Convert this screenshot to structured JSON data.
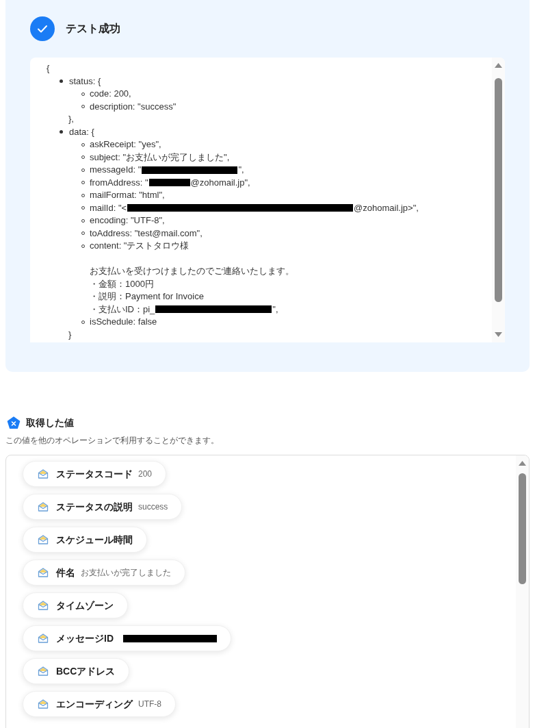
{
  "test_result": {
    "title": "テスト成功"
  },
  "json_view": {
    "open": "{",
    "items": [
      {
        "text": "status: {",
        "close": "},",
        "children": [
          {
            "lines": [
              {
                "segments": [
                  {
                    "kind": "text",
                    "text": "code: 200,"
                  }
                ]
              }
            ]
          },
          {
            "lines": [
              {
                "segments": [
                  {
                    "kind": "text",
                    "text": "description: \"success\""
                  }
                ]
              }
            ]
          }
        ]
      },
      {
        "text": "data: {",
        "close": "}",
        "children": [
          {
            "lines": [
              {
                "segments": [
                  {
                    "kind": "text",
                    "text": "askReceipt: \"yes\","
                  }
                ]
              }
            ]
          },
          {
            "lines": [
              {
                "segments": [
                  {
                    "kind": "text",
                    "text": "subject: \"お支払いが完了しました\","
                  }
                ]
              }
            ]
          },
          {
            "lines": [
              {
                "segments": [
                  {
                    "kind": "text",
                    "text": "messageId: \""
                  },
                  {
                    "kind": "mediumredaction"
                  },
                  {
                    "kind": "text",
                    "text": "\","
                  }
                ]
              }
            ]
          },
          {
            "lines": [
              {
                "segments": [
                  {
                    "kind": "text",
                    "text": "fromAddress: \""
                  },
                  {
                    "kind": "shortredaction"
                  },
                  {
                    "kind": "text",
                    "text": "@zohomail.jp\","
                  }
                ]
              }
            ]
          },
          {
            "lines": [
              {
                "segments": [
                  {
                    "kind": "text",
                    "text": "mailFormat: \"html\","
                  }
                ]
              }
            ]
          },
          {
            "lines": [
              {
                "segments": [
                  {
                    "kind": "text",
                    "text": "mailId: \"<"
                  },
                  {
                    "kind": "xlongredaction"
                  },
                  {
                    "kind": "text",
                    "text": "@zohomail.jp>\","
                  }
                ]
              }
            ]
          },
          {
            "lines": [
              {
                "segments": [
                  {
                    "kind": "text",
                    "text": "encoding: \"UTF-8\","
                  }
                ]
              }
            ]
          },
          {
            "lines": [
              {
                "segments": [
                  {
                    "kind": "text",
                    "text": "toAddress: \"test@mail.com\","
                  }
                ]
              }
            ]
          },
          {
            "lines": [
              {
                "segments": [
                  {
                    "kind": "text",
                    "text": "content: \"テストタロウ様"
                  }
                ]
              },
              {
                "gap_before": true,
                "segments": [
                  {
                    "kind": "text",
                    "text": "お支払いを受けつけましたのでご連絡いたします。"
                  }
                ]
              },
              {
                "segments": [
                  {
                    "kind": "text",
                    "text": "・金額：1000円"
                  }
                ]
              },
              {
                "segments": [
                  {
                    "kind": "text",
                    "text": "・説明：Payment for Invoice"
                  }
                ]
              },
              {
                "segments": [
                  {
                    "kind": "text",
                    "text": "・支払いID：pi_"
                  },
                  {
                    "kind": "longredaction"
                  },
                  {
                    "kind": "text",
                    "text": "\","
                  }
                ]
              }
            ]
          },
          {
            "lines": [
              {
                "segments": [
                  {
                    "kind": "text",
                    "text": "isSchedule: false"
                  }
                ]
              }
            ]
          }
        ]
      }
    ]
  },
  "outputs": {
    "title": "取得した値",
    "description": "この値を他のオペレーションで利用することができます。",
    "items": [
      {
        "label": "ステータスコード",
        "value": "200"
      },
      {
        "label": "ステータスの説明",
        "value": "success"
      },
      {
        "label": "スケジュール時間"
      },
      {
        "label": "件名",
        "value": "お支払いが完了しました"
      },
      {
        "label": "タイムゾーン"
      },
      {
        "label": "メッセージID",
        "value_redacted": true
      },
      {
        "label": "BCCアドレス"
      },
      {
        "label": "エンコーディング",
        "value": "UTF-8"
      }
    ]
  }
}
